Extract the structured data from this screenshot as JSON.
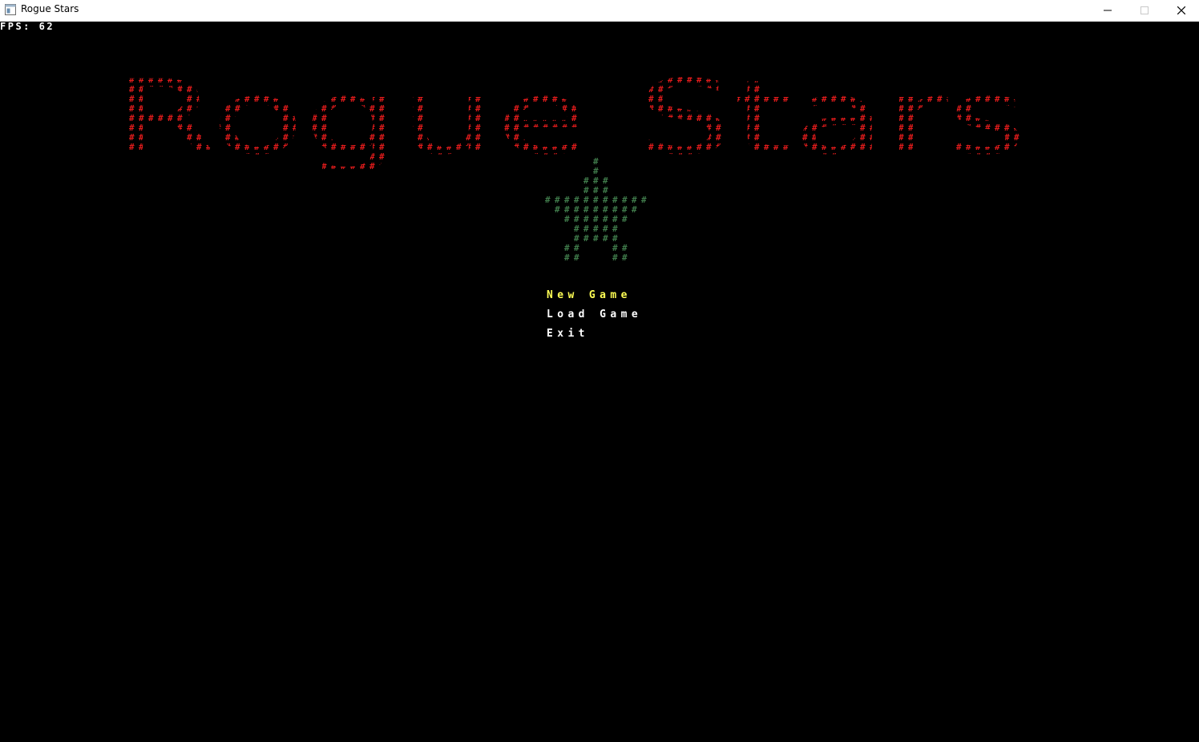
{
  "window": {
    "title": "Rogue Stars",
    "controls": [
      "minimize-icon",
      "maximize-icon",
      "close-icon"
    ]
  },
  "hud": {
    "fps_text": "FPS: 62"
  },
  "title_art": {
    "text": "Rogue Stars",
    "glyph": "#",
    "color": "#e01b1b"
  },
  "logo": {
    "glyph": "#",
    "color": "#3f7a4a",
    "rows": [
      "     #     ",
      "     #     ",
      "    ###    ",
      "    ###    ",
      "###########",
      " ######### ",
      "  #######  ",
      "   #####   ",
      "   #####   ",
      "  ##   ##  ",
      "  ##   ##  "
    ]
  },
  "menu": {
    "items": [
      {
        "label": "New Game",
        "selected": true
      },
      {
        "label": "Load Game",
        "selected": false
      },
      {
        "label": "Exit",
        "selected": false
      }
    ],
    "colors": {
      "selected": "#ffff55",
      "normal": "#ffffff"
    }
  }
}
